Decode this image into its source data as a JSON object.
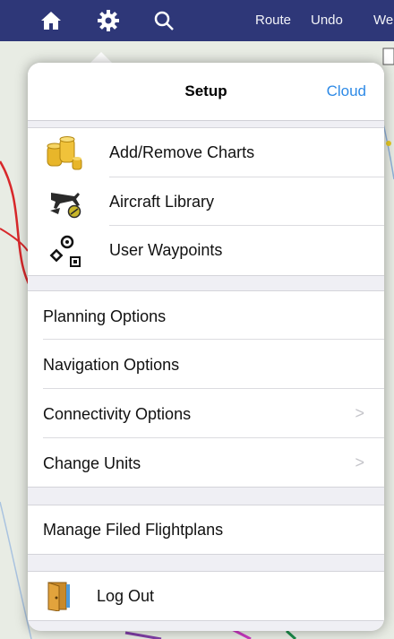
{
  "toolbar": {
    "route_label": "Route",
    "undo_label": "Undo",
    "partial_label": "We"
  },
  "setup": {
    "title": "Setup",
    "cloud_label": "Cloud",
    "charts_group": [
      {
        "label": "Add/Remove Charts",
        "icon": "gold-coins-icon"
      },
      {
        "label": "Aircraft Library",
        "icon": "aircraft-icon"
      },
      {
        "label": "User Waypoints",
        "icon": "waypoints-icon"
      }
    ],
    "options_group": [
      {
        "label": "Planning Options",
        "chevron": false
      },
      {
        "label": "Navigation Options",
        "chevron": false
      },
      {
        "label": "Connectivity Options",
        "chevron": true
      },
      {
        "label": "Change Units",
        "chevron": true
      }
    ],
    "flightplans_label": "Manage Filed Flightplans",
    "logout_label": "Log Out",
    "chevron_glyph": ">"
  },
  "colors": {
    "toolbar": "#2e3778",
    "accent": "#2e8ae6",
    "background": "#efeff4"
  }
}
